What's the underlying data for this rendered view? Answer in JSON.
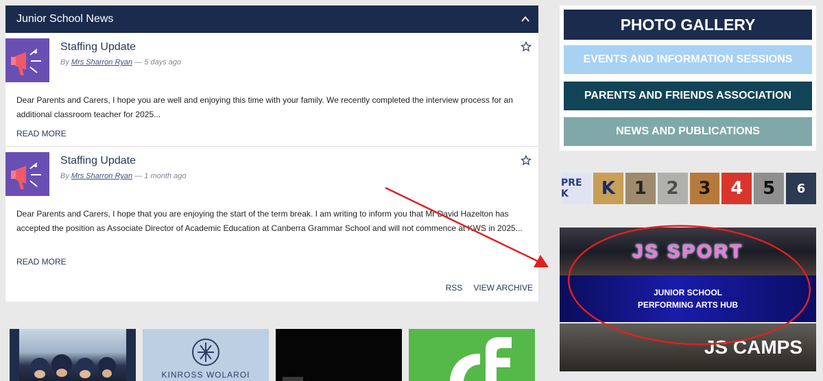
{
  "news": {
    "header_title": "Junior School News",
    "items": [
      {
        "title": "Staffing Update",
        "by": "By",
        "author": "Mrs Sharron Ryan",
        "age": "— 5 days ago",
        "body": "Dear Parents and Carers, I hope you are well and enjoying this time with your family. We recently completed the interview process for an additional classroom teacher for 2025...",
        "read_more": "READ MORE"
      },
      {
        "title": "Staffing Update",
        "by": "By",
        "author": "Mrs Sharron Ryan",
        "age": "— 1 month ago",
        "body": "Dear Parents and Carers, I hope that you are enjoying the start of the term break. I am writing to inform you that Mr David Hazelton has accepted the position as Associate Director of Academic Education at Canberra Grammar School and will not commence at KWS in 2025...",
        "read_more": "READ MORE"
      }
    ],
    "rss": "RSS",
    "view_archive": "VIEW ARCHIVE"
  },
  "thumbnails": {
    "kws_text": "KINROSS WOLAROI"
  },
  "sidebar": {
    "photo_gallery": "PHOTO GALLERY",
    "events": "EVENTS AND INFORMATION SESSIONS",
    "pfa": "PARENTS AND FRIENDS ASSOCIATION",
    "news_pubs": "NEWS AND PUBLICATIONS",
    "year_tiles": [
      "PRE K",
      "K",
      "1",
      "2",
      "3",
      "4",
      "5",
      "6"
    ],
    "sport": "JS SPORT",
    "arts_line1": "JUNIOR SCHOOL",
    "arts_line2": "PERFORMING ARTS HUB",
    "camps": "JS CAMPS"
  },
  "colors": {
    "navy": "#1b2b4d",
    "events_blue": "#a8d1f2",
    "pfa_teal": "#114457",
    "news_sage": "#81a8a8",
    "annotation_red": "#e02020"
  }
}
